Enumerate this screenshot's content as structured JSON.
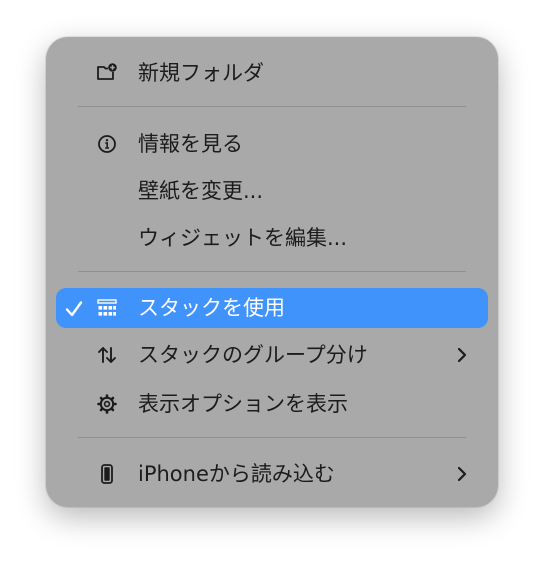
{
  "menu": {
    "items": [
      {
        "id": "new-folder",
        "label": "新規フォルダ",
        "icon": "folder-badge-plus-icon"
      },
      {
        "id": "get-info",
        "label": "情報を見る",
        "icon": "info-circle-icon"
      },
      {
        "id": "change-wallpaper",
        "label": "壁紙を変更..."
      },
      {
        "id": "edit-widgets",
        "label": "ウィジェットを編集..."
      },
      {
        "id": "use-stacks",
        "label": "スタックを使用",
        "icon": "stack-grid-icon",
        "checked": true,
        "selected": true
      },
      {
        "id": "group-stacks-by",
        "label": "スタックのグループ分け",
        "icon": "arrow-up-down-icon",
        "submenu": true
      },
      {
        "id": "show-view-options",
        "label": "表示オプションを表示",
        "icon": "gear-icon"
      },
      {
        "id": "import-from-iphone",
        "label": "iPhoneから読み込む",
        "icon": "iphone-icon",
        "submenu": true
      }
    ]
  },
  "colors": {
    "menu_background": "#a9a9a9",
    "selection": "#3f93fb",
    "text": "#1c1c1c",
    "separator": "#8f8f8f"
  }
}
